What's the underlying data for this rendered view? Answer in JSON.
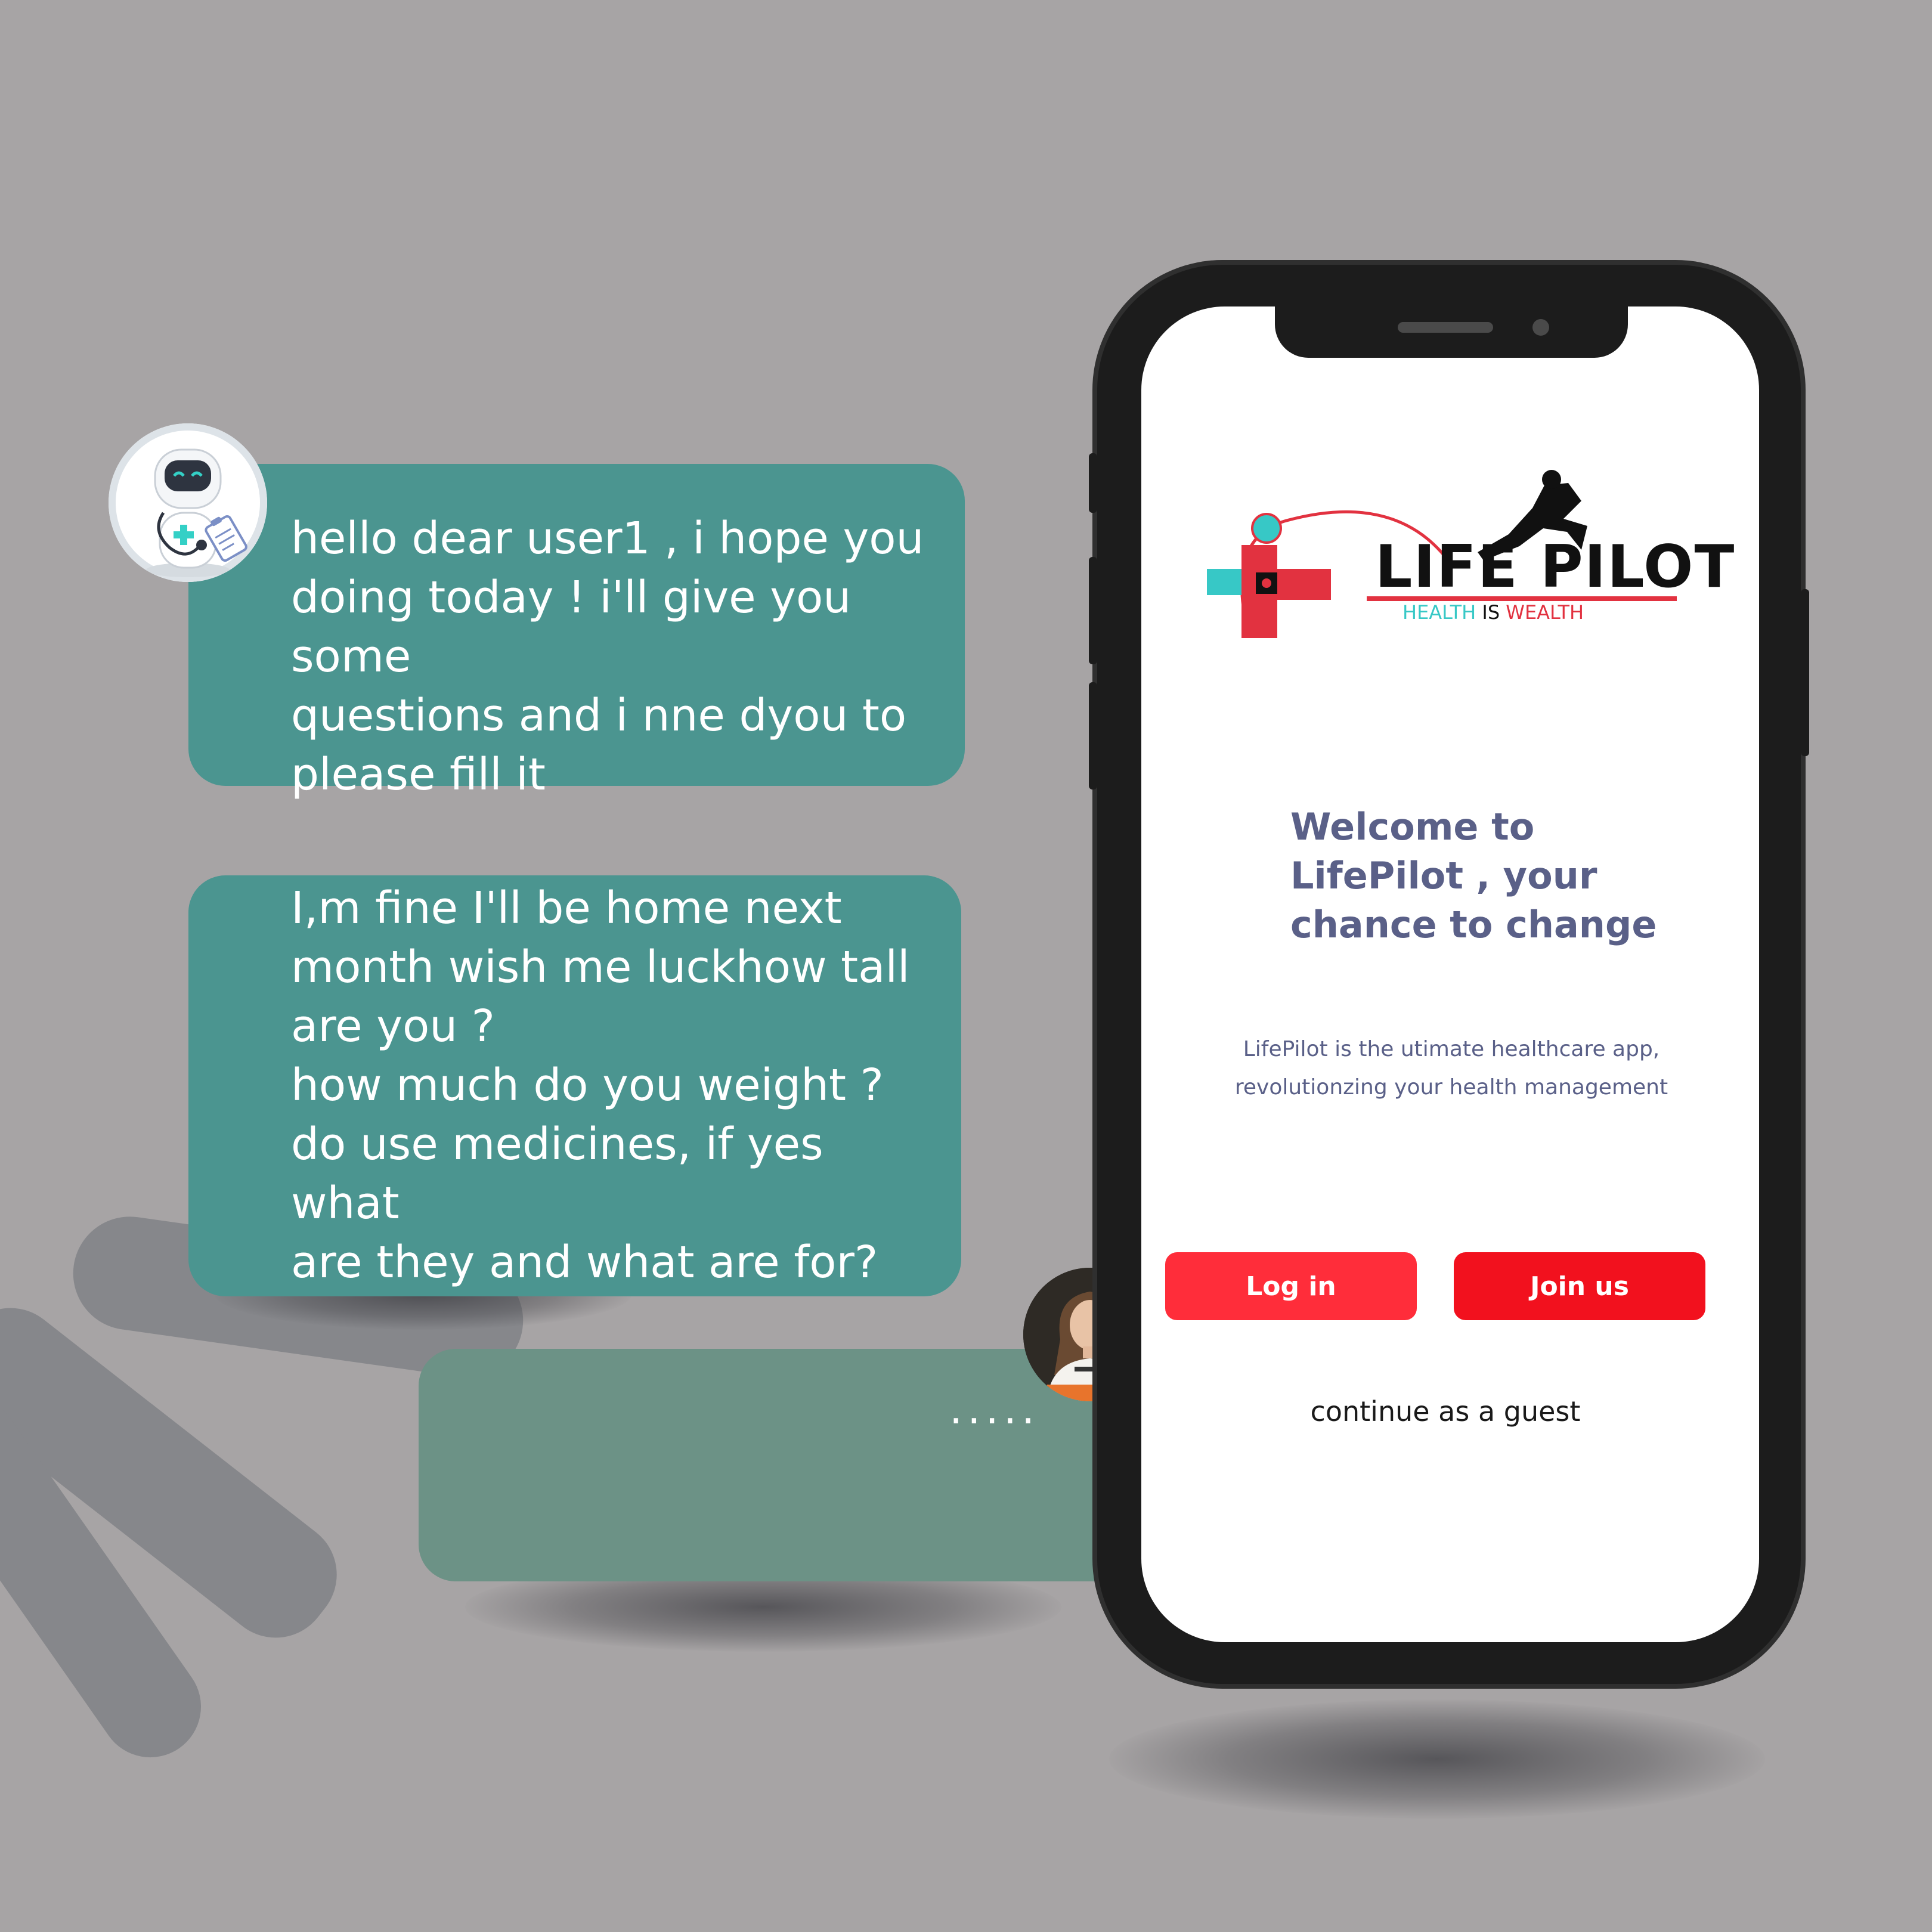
{
  "chat": {
    "bot_message": "hello dear user1 , i hope you\ndoing today ! i'll give you some\nquestions and i nne dyou to\nplease fill it",
    "user_message": "I,m fine I'll be home next\nmonth wish me luckhow tall\nare you ?\nhow much do you weight ?\ndo use medicines, if yes what\nare they and what are for?",
    "typing_indicator": ".....",
    "bot_avatar_icon": "robot-doctor-icon",
    "user_avatar_icon": "user-photo-avatar",
    "bubble_color": "#4b9590",
    "reply_bubble_color": "#6c9286"
  },
  "phone": {
    "logo": {
      "title": "LIFE PILOT",
      "tagline_health": "HEALTH",
      "tagline_is": "IS",
      "tagline_wealth": "WEALTH"
    },
    "welcome_title": "Welcome to\nLifePilot , your\nchance to change",
    "subtitle": "LifePilot is the utimate healthcare app,\nrevolutionzing your health management",
    "login_label": "Log in",
    "join_label": "Join us",
    "guest_label": "continue as a guest",
    "accent_red": "#f2111e",
    "accent_teal": "#37c8c6"
  }
}
